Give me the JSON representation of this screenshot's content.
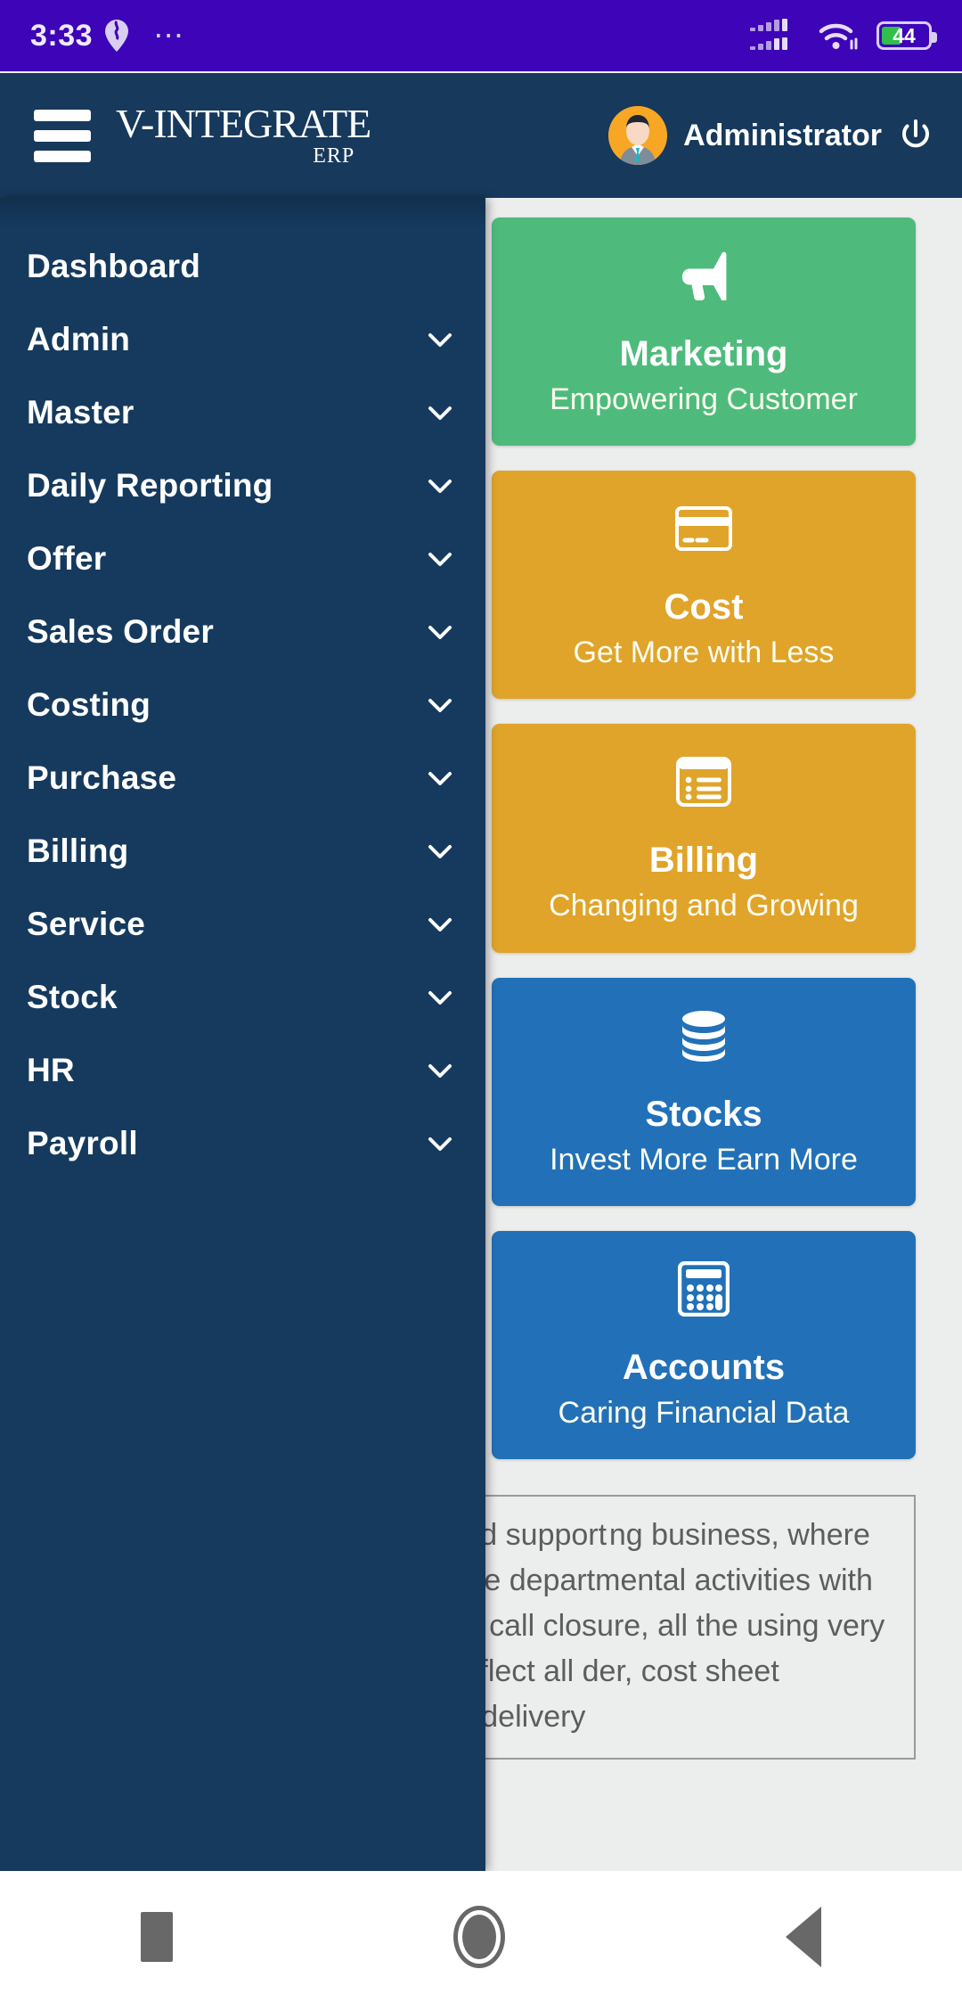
{
  "status_bar": {
    "time": "3:33",
    "overflow_dots": "⋯",
    "battery_percent": "44",
    "icons": [
      "location-pin-icon",
      "signal-bars-icon",
      "wifi-icon",
      "battery-icon"
    ],
    "background_color": "#3d04b8"
  },
  "header": {
    "menu_icon": "hamburger-menu-icon",
    "logo_main": "V-INTEGRATE",
    "logo_sub": "ERP",
    "user_name": "Administrator",
    "avatar_icon": "user-avatar-icon",
    "power_icon": "power-logout-icon",
    "background_color": "#16395c"
  },
  "sidebar": {
    "items": [
      {
        "label": "Dashboard",
        "has_chevron": false
      },
      {
        "label": "Admin",
        "has_chevron": true
      },
      {
        "label": "Master",
        "has_chevron": true
      },
      {
        "label": "Daily Reporting",
        "has_chevron": true
      },
      {
        "label": "Offer",
        "has_chevron": true
      },
      {
        "label": "Sales Order",
        "has_chevron": true
      },
      {
        "label": "Costing",
        "has_chevron": true
      },
      {
        "label": "Purchase",
        "has_chevron": true
      },
      {
        "label": "Billing",
        "has_chevron": true
      },
      {
        "label": "Service",
        "has_chevron": true
      },
      {
        "label": "Stock",
        "has_chevron": true
      },
      {
        "label": "HR",
        "has_chevron": true
      },
      {
        "label": "Payroll",
        "has_chevron": true
      }
    ],
    "background_color": "#153a5e"
  },
  "main": {
    "cards": [
      {
        "title": "Marketing",
        "subtitle": "Empowering Customer",
        "icon": "megaphone-icon",
        "color": "#4ebb7c"
      },
      {
        "title": "Cost",
        "subtitle": "Get More with Less",
        "icon": "credit-card-icon",
        "color": "#e0a42a"
      },
      {
        "title": "Billing",
        "subtitle": "Changing and Growing",
        "icon": "invoice-list-icon",
        "color": "#e0a42a"
      },
      {
        "title": "Stocks",
        "subtitle": "Invest More Earn More",
        "icon": "database-stack-icon",
        "color": "#2271b8"
      },
      {
        "title": "Accounts",
        "subtitle": "Caring Financial Data",
        "icon": "calculator-icon",
        "color": "#2271b8"
      }
    ],
    "info_text": "all registration etc. V- d sales and support ng business, where sales, activities are involved. The departmental activities with a g from offer generation to n to call closure, all the using very simple and easy of entry and reflect all der, cost sheet generation, service installation, delivery"
  },
  "android_nav": {
    "recents_icon": "square-recents-icon",
    "home_icon": "circle-home-icon",
    "back_icon": "triangle-back-icon"
  }
}
